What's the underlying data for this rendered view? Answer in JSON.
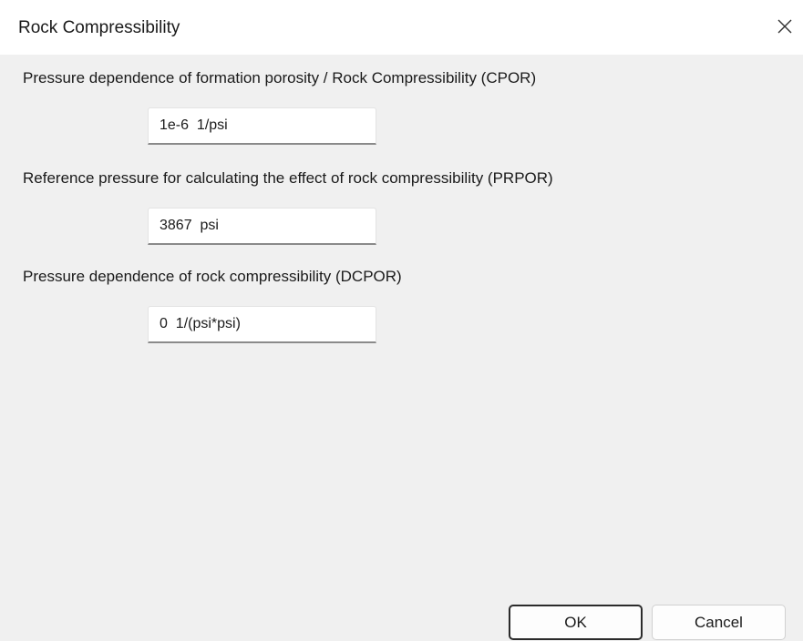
{
  "window": {
    "title": "Rock Compressibility",
    "close_icon": "close-icon"
  },
  "fields": [
    {
      "label": "Pressure dependence of formation porosity / Rock Compressibility (CPOR)",
      "value": "1e-6  1/psi"
    },
    {
      "label": "Reference pressure for calculating the effect of rock compressibility (PRPOR)",
      "value": "3867  psi"
    },
    {
      "label": "Pressure dependence of rock compressibility (DCPOR)",
      "value": "0  1/(psi*psi)"
    }
  ],
  "buttons": {
    "ok_label": "OK",
    "cancel_label": "Cancel"
  },
  "colors": {
    "background": "#f0f0f0",
    "titlebar": "#ffffff",
    "input_underline": "#8a8a8a",
    "default_button_border": "#2b2b2b"
  }
}
